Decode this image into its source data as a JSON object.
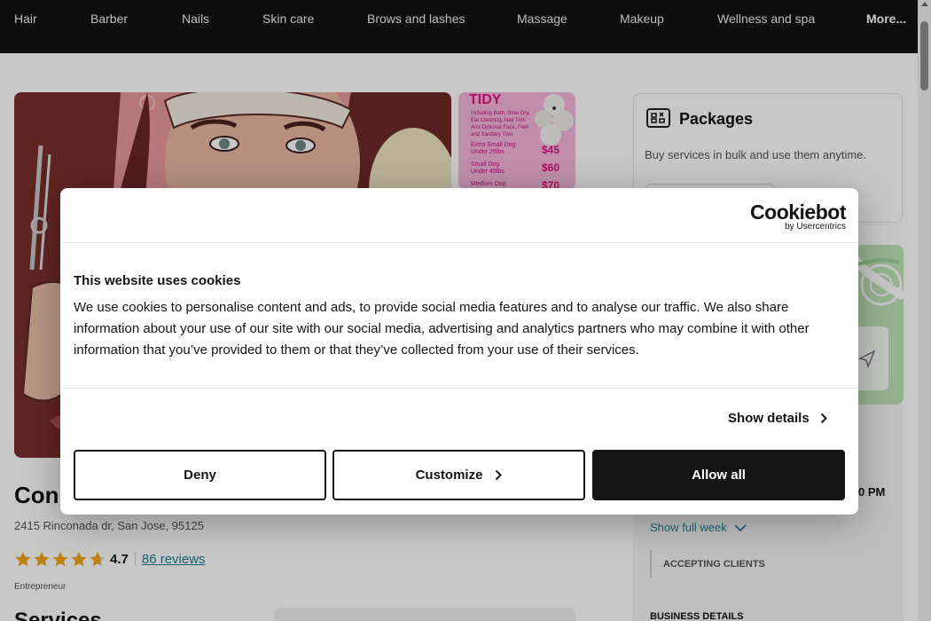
{
  "nav": {
    "items": [
      "Hair",
      "Barber",
      "Nails",
      "Skin care",
      "Brows and lashes",
      "Massage",
      "Makeup",
      "Wellness and spa"
    ],
    "more": "More..."
  },
  "gallery": {
    "thumb": {
      "title": "TIDY",
      "lines": [
        "Including Bath, Blow Dry,",
        "Ear Cleaning, Nail Trim",
        "And Optional Face, Feet",
        "and Sanitary Trim",
        "Extra Small Dog",
        "Under 25lbs",
        "Small Dog",
        "Under 45lbs",
        "Medium Dog"
      ],
      "prices": [
        "$45",
        "$60",
        "$70"
      ]
    }
  },
  "business": {
    "name_partial": "Con",
    "address": "2415 Rinconada dr, San Jose, 95125",
    "rating": "4.7",
    "stars": 4.7,
    "reviews": "86 reviews",
    "type": "Entrepreneur",
    "services_heading_partial": "Services"
  },
  "packages": {
    "title": "Packages",
    "description": "Buy services in bulk and use them anytime."
  },
  "hours": {
    "time_partial": "0 PM",
    "show_full_week": "Show full week",
    "accepting": "ACCEPTING CLIENTS",
    "business_details": "BUSINESS DETAILS"
  },
  "cookie": {
    "brand": "Cookiebot",
    "brand_sub": "by Usercentrics",
    "title": "This website uses cookies",
    "body": "We use cookies to personalise content and ads, to provide social media features and to analyse our traffic. We also share information about your use of our site with our social media, advertising and analytics partners who may combine it with other information that you’ve provided to them or that they’ve collected from your use of their services.",
    "show_details": "Show details",
    "deny": "Deny",
    "customize": "Customize",
    "allow_all": "Allow all"
  },
  "colors": {
    "nav_bg": "#121212",
    "link": "#1b7e92",
    "star": "#f0a818",
    "dialog_dark": "#141414"
  }
}
